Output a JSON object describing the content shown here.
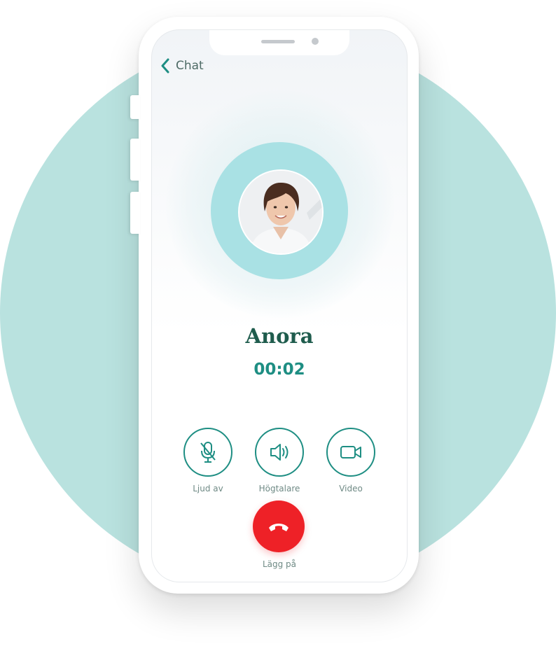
{
  "header": {
    "back_label": "Chat"
  },
  "caller": {
    "name": "Anora",
    "duration": "00:02"
  },
  "controls": [
    {
      "label": "Ljud av",
      "icon": "mic-off-icon"
    },
    {
      "label": "Högtalare",
      "icon": "speaker-icon"
    },
    {
      "label": "Video",
      "icon": "video-camera-icon"
    }
  ],
  "hangup": {
    "label": "Lägg på",
    "icon": "phone-hangup-icon"
  },
  "colors": {
    "background_circle": "#b9e2df",
    "accent": "#1e8e83",
    "name": "#1f5c4d",
    "hangup": "#ee2127",
    "avatar_ring": "#a9e1e4"
  }
}
